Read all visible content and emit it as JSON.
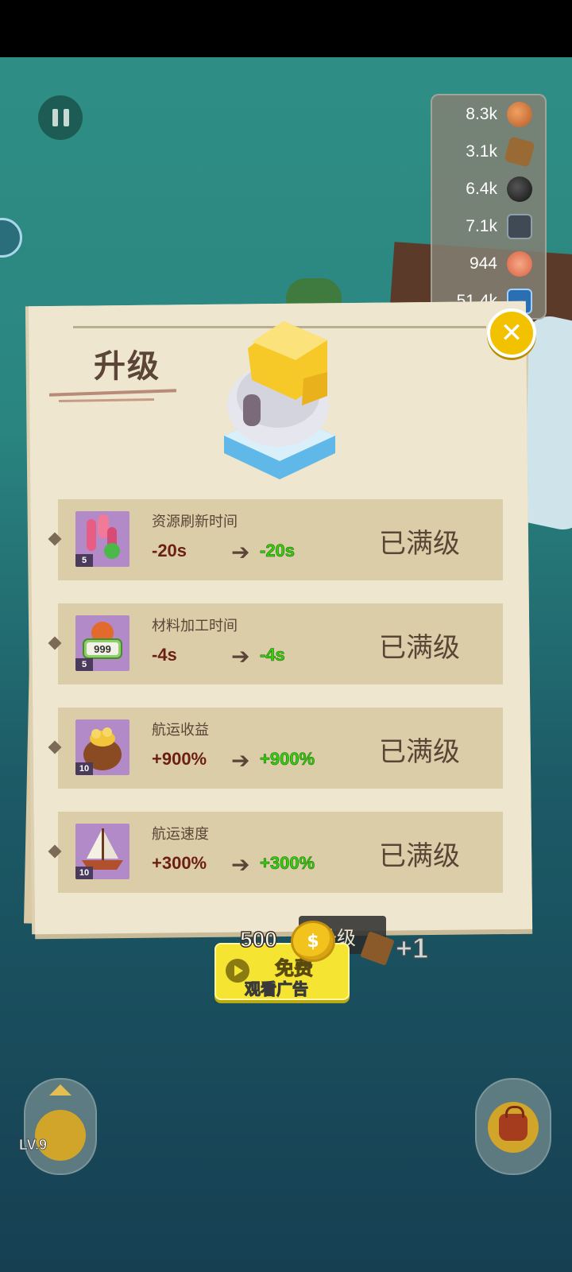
{
  "resources": [
    {
      "value": "8.3k",
      "icon": "copper-ore-icon"
    },
    {
      "value": "3.1k",
      "icon": "wood-cube-icon"
    },
    {
      "value": "6.4k",
      "icon": "bomb-icon"
    },
    {
      "value": "7.1k",
      "icon": "iron-block-icon"
    },
    {
      "value": "944",
      "icon": "salmon-steak-icon"
    },
    {
      "value": "51.4k",
      "icon": "blue-gem-icon"
    }
  ],
  "dialog": {
    "title": "升级",
    "rows": [
      {
        "label": "资源刷新时间",
        "level": "5",
        "from": "-20s",
        "to": "-20s",
        "status": "已满级",
        "icon": "coral-refresh-icon"
      },
      {
        "label": "材料加工时间",
        "level": "5",
        "from": "-4s",
        "to": "-4s",
        "status": "已满级",
        "icon": "ore-999-icon"
      },
      {
        "label": "航运收益",
        "level": "10",
        "from": "+900%",
        "to": "+900%",
        "status": "已满级",
        "icon": "gold-sack-icon"
      },
      {
        "label": "航运速度",
        "level": "10",
        "from": "+300%",
        "to": "+300%",
        "status": "已满级",
        "icon": "sailboat-icon"
      }
    ]
  },
  "ad": {
    "price": "500",
    "free_label": "免费",
    "watch_label": "观看广告"
  },
  "behind": {
    "upgrade_label": "升级",
    "plus": "+1"
  },
  "level_button": {
    "label": "LV.9"
  },
  "colors": {
    "accent_yellow": "#f5e431",
    "green_value": "#36d00f",
    "brown_text": "#5a4536",
    "parchment": "#efe6cf"
  }
}
